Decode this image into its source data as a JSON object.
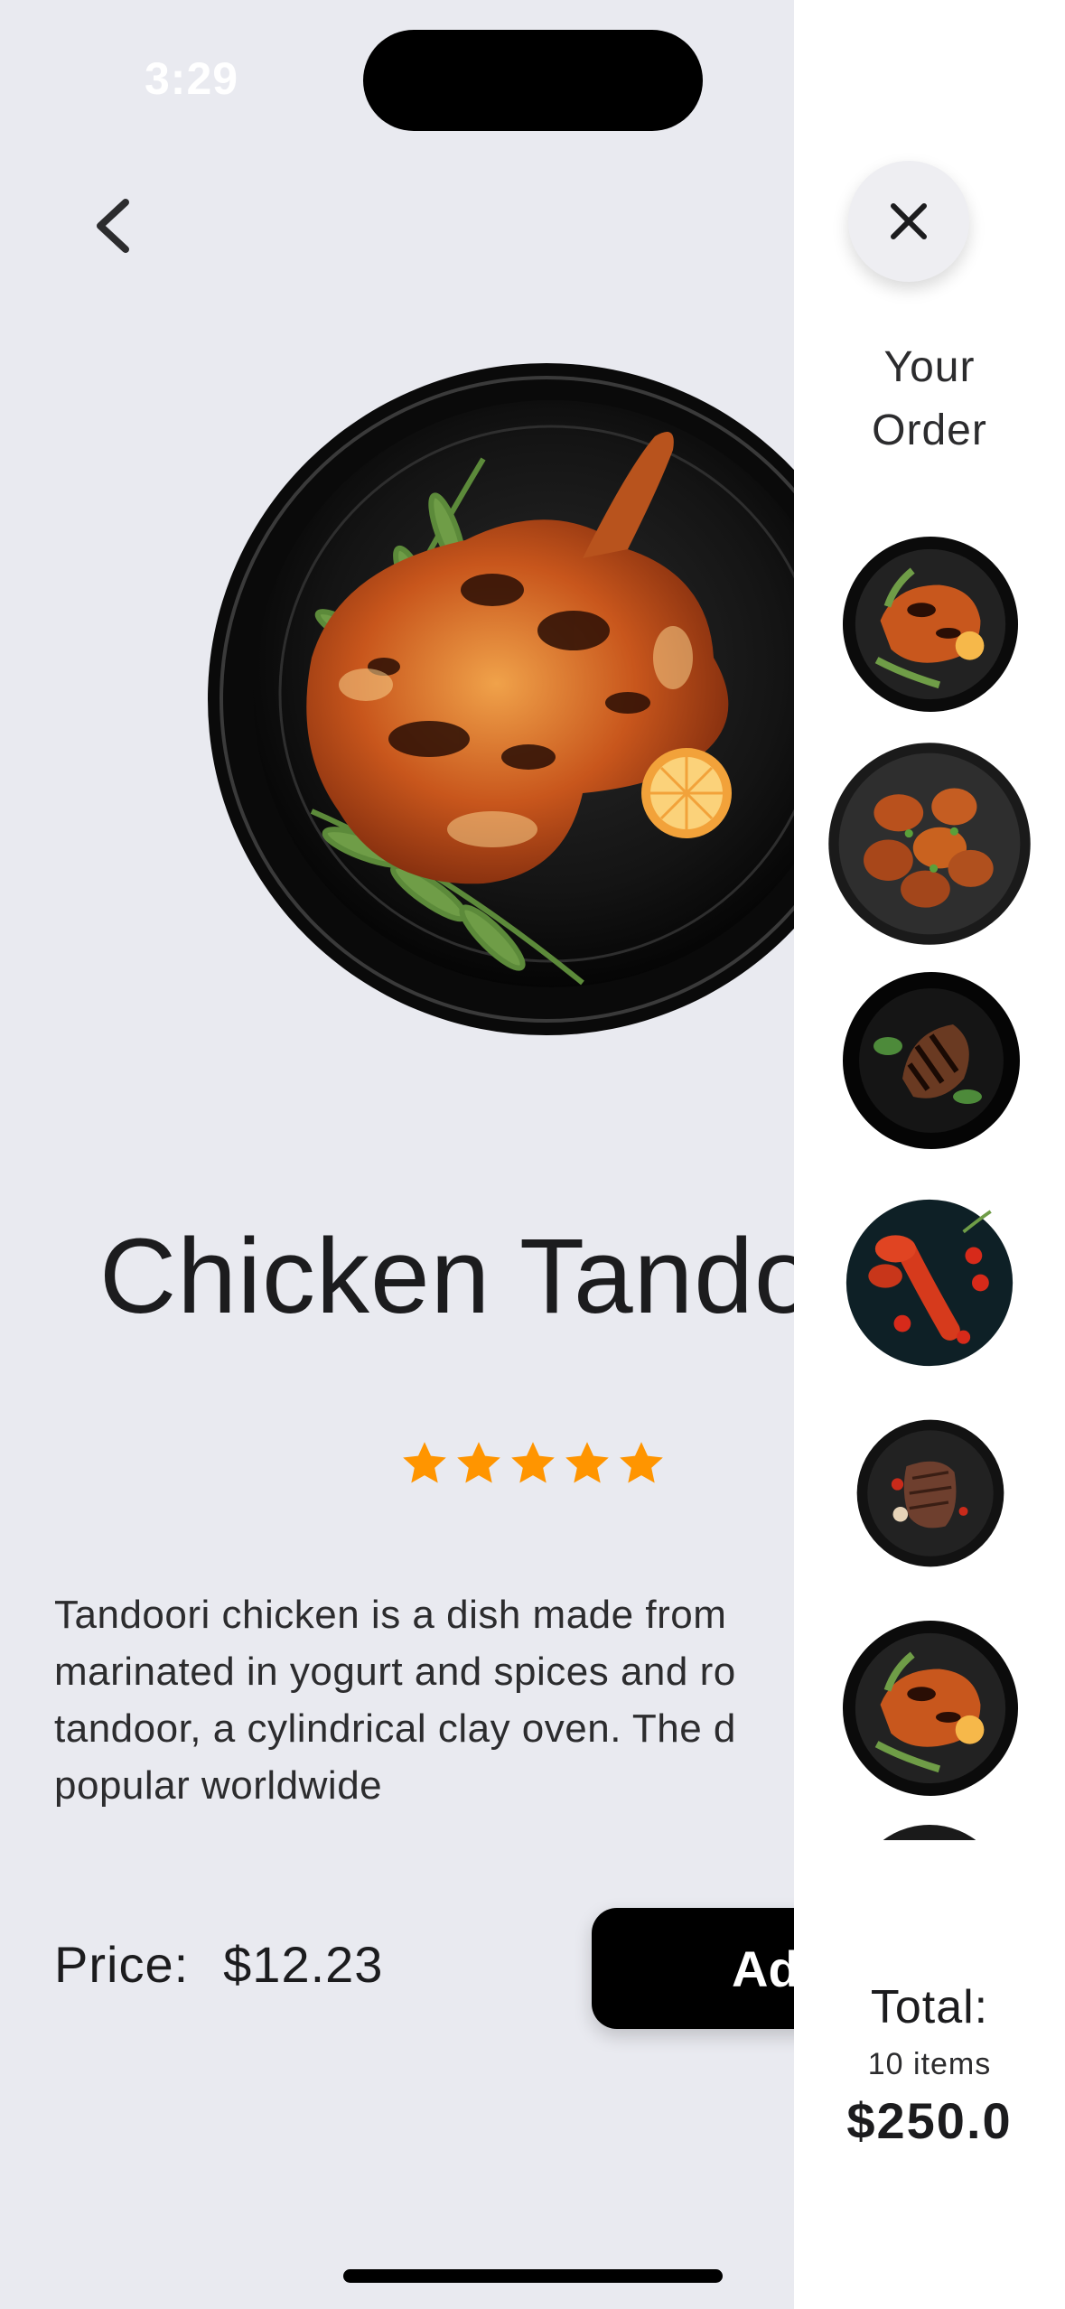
{
  "status_bar": {
    "time": "3:29"
  },
  "product": {
    "title": "Chicken Tandoori",
    "rating": 5,
    "description_lines": [
      "Tandoori chicken is a dish made from",
      "marinated in yogurt and spices and ro",
      "tandoor, a cylindrical clay oven. The d",
      "popular worldwide"
    ],
    "price_label": "Price:",
    "price_value": "$12.23",
    "add_button_label": "Ad"
  },
  "order_panel": {
    "title_line1": "Your",
    "title_line2": "Order",
    "items": [
      {
        "dish": "chicken-tandoori"
      },
      {
        "dish": "chicken-wings"
      },
      {
        "dish": "grilled-chicken"
      },
      {
        "dish": "lobster"
      },
      {
        "dish": "steak"
      },
      {
        "dish": "chicken-tandoori"
      },
      {
        "dish": "partial"
      }
    ],
    "total_label": "Total:",
    "item_count": "10 items",
    "total_amount": "$250.0"
  },
  "colors": {
    "background": "#e9eaf0",
    "panel": "#ffffff",
    "star": "#ff9500",
    "button": "#000000"
  },
  "icons": [
    "chevron-left-icon",
    "close-icon",
    "star-icon"
  ]
}
